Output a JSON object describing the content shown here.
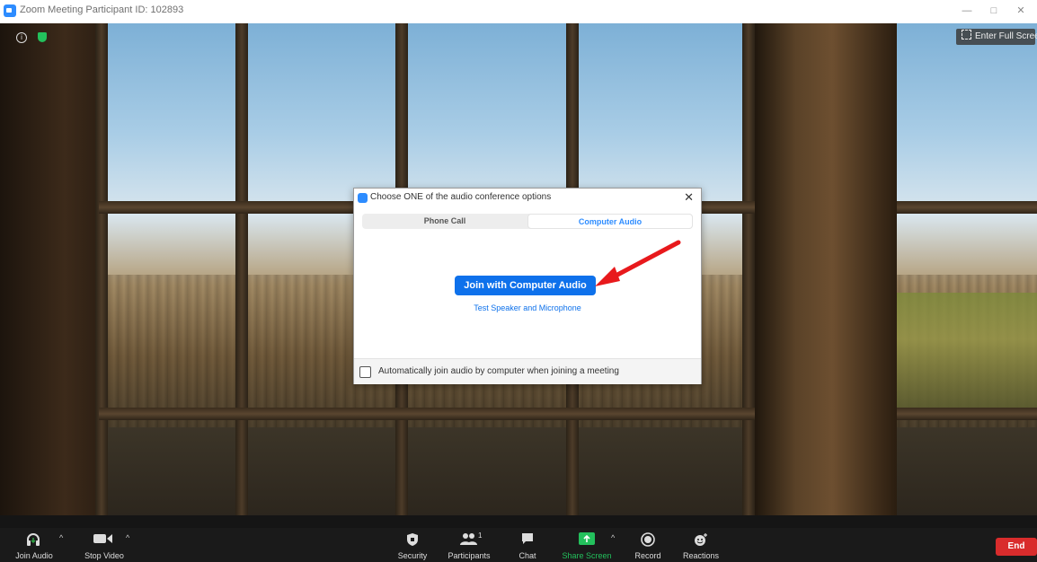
{
  "window": {
    "title": "Zoom Meeting Participant ID: 102893",
    "minimize": "—",
    "maximize": "□",
    "close": "✕"
  },
  "video": {
    "info_icon": "i",
    "fullscreen_label": "Enter Full Screen"
  },
  "dialog": {
    "title": "Choose ONE of the audio conference options",
    "close": "✕",
    "tabs": [
      {
        "label": "Phone Call",
        "selected": false
      },
      {
        "label": "Computer Audio",
        "selected": true
      }
    ],
    "join_button": "Join with Computer Audio",
    "test_link": "Test Speaker and Microphone",
    "auto_join_label": "Automatically join audio by computer when joining a meeting",
    "auto_join_checked": false
  },
  "toolbar": {
    "join_audio": "Join Audio",
    "stop_video": "Stop Video",
    "security": "Security",
    "participants": "Participants",
    "participants_count": "1",
    "chat": "Chat",
    "share_screen": "Share Screen",
    "record": "Record",
    "reactions": "Reactions",
    "end": "End",
    "caret": "^"
  },
  "colors": {
    "accent": "#0e71eb",
    "share_green": "#23c05c",
    "end_red": "#d92c2c",
    "annotation_arrow": "#e8191c"
  }
}
